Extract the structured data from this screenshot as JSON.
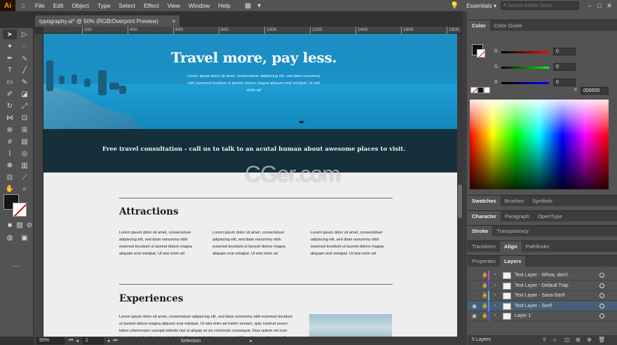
{
  "app": {
    "logo": "Ai",
    "menu": [
      "File",
      "Edit",
      "Object",
      "Type",
      "Select",
      "Effect",
      "View",
      "Window",
      "Help"
    ],
    "workspace": "Essentials",
    "stock_search_placeholder": "Search Adobe Stock",
    "window_controls": [
      "–",
      "□",
      "✕"
    ]
  },
  "document": {
    "tab_title": "typography.ai* @ 50% (RGB/Overprint Preview)",
    "close": "×"
  },
  "ruler": {
    "ticks": [
      "200",
      "400",
      "600",
      "800",
      "1000",
      "1200",
      "1400",
      "1600",
      "1800"
    ]
  },
  "artboard": {
    "hero_title": "Travel more, pay less.",
    "hero_body": "Lorem ipsum dolor sit amet, consectetuer adipiscing elit, sed diam nonummy nibh euismod tincidunt ut laoreet dolore magna aliquam erat volutpat. Ut wisi enim ad",
    "band_text": "Free travel consultation - call us to talk to an acutal human about awesome places to visit.",
    "attractions_title": "Attractions",
    "attractions_cols": [
      "Lorem ipsum dolor sit amet, consectetuer adipiscing elit, sed diam nonummy nibh euismod tincidunt ut laoreet dolore magna aliquam erat volutpat. Ut wisi enim ad",
      "Lorem ipsum dolor sit amet, consectetuer adipiscing elit, sed diam nonummy nibh euismod tincidunt ut laoreet dolore magna aliquam erat volutpat. Ut wisi enim ad",
      "Lorem ipsum dolor sit amet, consectetuer adipiscing elit, sed diam nonummy nibh euismod tincidunt ut laoreet dolore magna aliquam erat volutpat. Ut wisi enim ad"
    ],
    "experiences_title": "Experiences",
    "experiences_body": "Lorem ipsum dolor sit amet, consectetuer adipiscing elit, sed diam nonummy nibh euismod tincidunt ut laoreet dolore magna aliquam erat volutpat. Ut wisi enim ad minim veniam, quis nostrud exerci tation ullamcorper suscipit lobortis nisl ut aliquip ex ea commodo consequat. Duis autem vel eum iriure dolor in hendrerit in vulputate velit esse molestie consequat, vel illum dolore eu feugiat nulla facilisis at vero eros et accumsan et iusto odio dignissim qui blandit",
    "watermark": "CGer.com"
  },
  "status": {
    "zoom": "50%",
    "artboard_number": "1",
    "tool": "Selection"
  },
  "color_panel": {
    "tabs": [
      "Color",
      "Color Guide"
    ],
    "channels": [
      {
        "label": "R",
        "value": "0",
        "gradient": "#ff0000"
      },
      {
        "label": "G",
        "value": "0",
        "gradient": "#00ff00"
      },
      {
        "label": "B",
        "value": "0",
        "gradient": "#0000ff"
      }
    ],
    "hex_label": "#",
    "hex": "000000"
  },
  "panel_groups": {
    "swatches_tabs": [
      "Swatches",
      "Brushes",
      "Symbols"
    ],
    "character_tabs": [
      "Character",
      "Paragraph",
      "OpenType"
    ],
    "stroke_tabs": [
      "Stroke",
      "Transparency"
    ],
    "transform_tabs": [
      "Transform",
      "Align",
      "Pathfinder"
    ],
    "layers_tabs": [
      "Properties",
      "Layers"
    ]
  },
  "layers": {
    "items": [
      {
        "name": "Text Layer - Whoa, don't.",
        "color": "#c154c1",
        "visible": false,
        "selected": false
      },
      {
        "name": "Text Layer - Default Trap",
        "color": "#4f4fff",
        "visible": false,
        "selected": false
      },
      {
        "name": "Text Layer - Sans-Serif",
        "color": "#4fc1c1",
        "visible": false,
        "selected": false
      },
      {
        "name": "Text Layer - Serif",
        "color": "#4f8fff",
        "visible": true,
        "selected": true
      },
      {
        "name": "Layer 1",
        "color": "#4f4fff",
        "visible": true,
        "selected": false
      }
    ],
    "count": "5 Layers"
  }
}
